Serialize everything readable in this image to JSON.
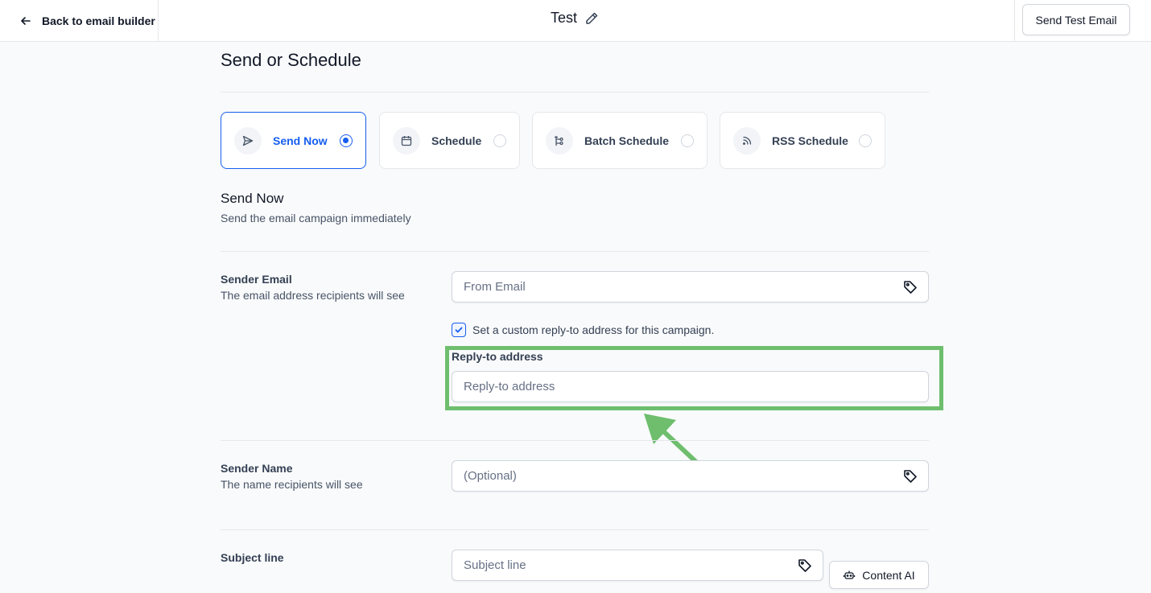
{
  "header": {
    "back_label": "Back to email builder",
    "title": "Test",
    "send_test_label": "Send Test Email"
  },
  "page": {
    "title": "Send or Schedule"
  },
  "options": [
    {
      "label": "Send Now",
      "icon": "send-icon",
      "selected": true
    },
    {
      "label": "Schedule",
      "icon": "calendar-icon",
      "selected": false
    },
    {
      "label": "Batch Schedule",
      "icon": "batch-icon",
      "selected": false
    },
    {
      "label": "RSS Schedule",
      "icon": "rss-icon",
      "selected": false
    }
  ],
  "section": {
    "title": "Send Now",
    "subtitle": "Send the email campaign immediately"
  },
  "sender_email": {
    "label": "Sender Email",
    "help": "The email address recipients will see",
    "placeholder": "From Email",
    "value": ""
  },
  "reply_to": {
    "checkbox_label": "Set a custom reply-to address for this campaign.",
    "checked": true,
    "label": "Reply-to address",
    "placeholder": "Reply-to address",
    "value": ""
  },
  "sender_name": {
    "label": "Sender Name",
    "help": "The name recipients will see",
    "placeholder": "(Optional)",
    "value": ""
  },
  "subject": {
    "label": "Subject line",
    "placeholder": "Subject line",
    "value": "",
    "content_ai_label": "Content AI"
  },
  "colors": {
    "accent": "#155eef",
    "highlight": "#6ebe6e"
  }
}
